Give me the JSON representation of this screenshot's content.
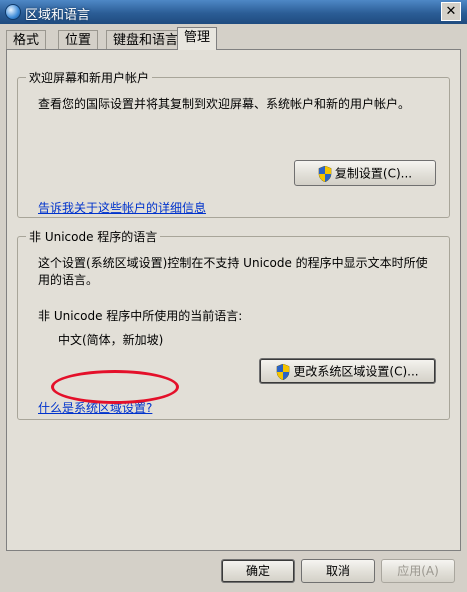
{
  "window": {
    "title": "区域和语言",
    "close_label": "✕"
  },
  "tabs": [
    {
      "label": "格式"
    },
    {
      "label": "位置"
    },
    {
      "label": "键盘和语言"
    },
    {
      "label": "管理",
      "active": true
    }
  ],
  "welcome_group": {
    "title": "欢迎屏幕和新用户帐户",
    "description": "查看您的国际设置并将其复制到欢迎屏幕、系统帐户和新的用户帐户。",
    "copy_button": "复制设置(C)...",
    "link": "告诉我关于这些帐户的详细信息"
  },
  "unicode_group": {
    "title": "非 Unicode 程序的语言",
    "description_line1": "这个设置(系统区域设置)控制在不支持 Unicode 的程序中显示文本时所使",
    "description_line2": "用的语言。",
    "current_label": "非 Unicode 程序中所使用的当前语言:",
    "current_value": "中文(简体，新加坡)",
    "change_button": "更改系统区域设置(C)...",
    "link": "什么是系统区域设置?"
  },
  "footer": {
    "ok": "确定",
    "cancel": "取消",
    "apply": "应用(A)"
  },
  "colors": {
    "annotation": "#e4102a",
    "link": "#0033cc"
  }
}
